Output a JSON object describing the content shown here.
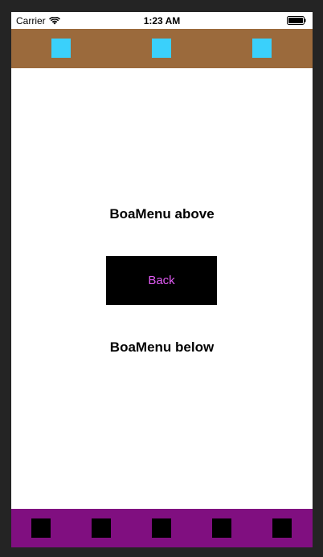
{
  "status_bar": {
    "carrier": "Carrier",
    "time": "1:23 AM",
    "wifi_icon": "wifi-icon",
    "battery_icon": "battery-icon"
  },
  "top_menu": {
    "color": "#9b6a3c",
    "item_color": "#3ad0fb",
    "items": [
      "menu-item",
      "menu-item",
      "menu-item"
    ]
  },
  "content": {
    "label_above": "BoaMenu above",
    "back_label": "Back",
    "label_below": "BoaMenu below",
    "back_text_color": "#e25bf5"
  },
  "bottom_menu": {
    "color": "#800f80",
    "item_color": "#000000",
    "items": [
      "menu-item",
      "menu-item",
      "menu-item",
      "menu-item",
      "menu-item"
    ]
  }
}
